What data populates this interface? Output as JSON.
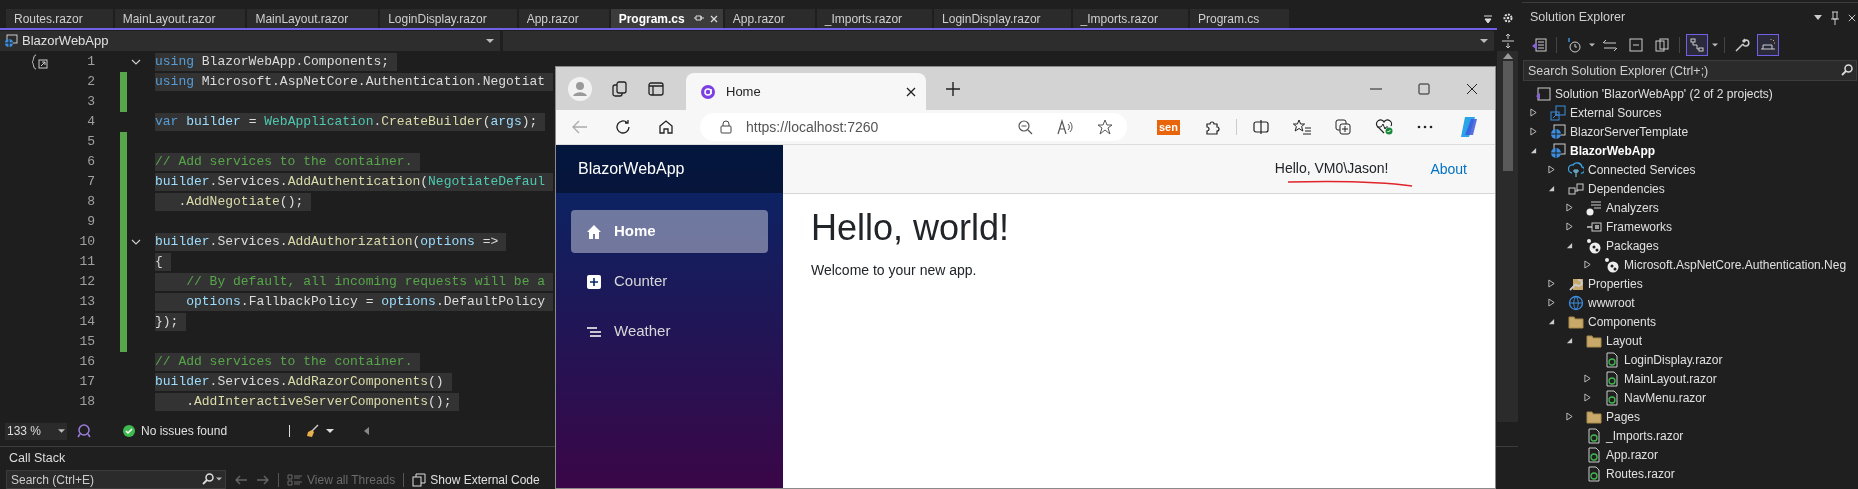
{
  "editor_tabs": [
    {
      "label": "Routes.razor",
      "selected": false
    },
    {
      "label": "MainLayout.razor",
      "selected": false
    },
    {
      "label": "MainLayout.razor",
      "selected": false
    },
    {
      "label": "LoginDisplay.razor",
      "selected": false
    },
    {
      "label": "App.razor",
      "selected": false
    },
    {
      "label": "Program.cs",
      "selected": true
    },
    {
      "label": "App.razor",
      "selected": false
    },
    {
      "label": "_Imports.razor",
      "selected": false
    },
    {
      "label": "LoginDisplay.razor",
      "selected": false
    },
    {
      "label": "_Imports.razor",
      "selected": false
    },
    {
      "label": "Program.cs",
      "selected": false
    }
  ],
  "navigation_bar": {
    "project": "BlazorWebApp"
  },
  "code_lines": [
    {
      "number": "1",
      "changed": false,
      "fold": true,
      "segments": [
        {
          "kind": "keyword",
          "text": "using"
        },
        {
          "kind": "plain",
          "text": " BlazorWebApp.Components;"
        }
      ]
    },
    {
      "number": "2",
      "changed": true,
      "fold": false,
      "segments": [
        {
          "kind": "keyword",
          "text": "using"
        },
        {
          "kind": "plain",
          "text": " Microsoft.AspNetCore.Authentication.Negotiat"
        }
      ]
    },
    {
      "number": "3",
      "changed": true,
      "fold": false
    },
    {
      "number": "4",
      "changed": false,
      "fold": false,
      "segments": [
        {
          "kind": "keyword",
          "text": "var"
        },
        {
          "kind": "variable",
          "text": " builder"
        },
        {
          "kind": "plain",
          "text": " = "
        },
        {
          "kind": "type",
          "text": "WebApplication"
        },
        {
          "kind": "plain",
          "text": "."
        },
        {
          "kind": "method",
          "text": "CreateBuilder"
        },
        {
          "kind": "plain",
          "text": "("
        },
        {
          "kind": "variable",
          "text": "args"
        },
        {
          "kind": "plain",
          "text": ");"
        }
      ]
    },
    {
      "number": "5",
      "changed": true,
      "fold": false
    },
    {
      "number": "6",
      "changed": true,
      "fold": false,
      "segments": [
        {
          "kind": "comment",
          "text": "// Add services to the container."
        }
      ]
    },
    {
      "number": "7",
      "changed": true,
      "fold": false,
      "segments": [
        {
          "kind": "variable",
          "text": "builder"
        },
        {
          "kind": "plain",
          "text": ".Services."
        },
        {
          "kind": "method",
          "text": "AddAuthentication"
        },
        {
          "kind": "plain",
          "text": "("
        },
        {
          "kind": "type",
          "text": "NegotiateDefaul"
        }
      ]
    },
    {
      "number": "8",
      "changed": true,
      "fold": false,
      "segments": [
        {
          "kind": "plain",
          "text": "   ."
        },
        {
          "kind": "method",
          "text": "AddNegotiate"
        },
        {
          "kind": "plain",
          "text": "();"
        }
      ]
    },
    {
      "number": "9",
      "changed": true,
      "fold": false
    },
    {
      "number": "10",
      "changed": true,
      "fold": true,
      "segments": [
        {
          "kind": "variable",
          "text": "builder"
        },
        {
          "kind": "plain",
          "text": ".Services."
        },
        {
          "kind": "method",
          "text": "AddAuthorization"
        },
        {
          "kind": "plain",
          "text": "("
        },
        {
          "kind": "variable",
          "text": "options"
        },
        {
          "kind": "plain",
          "text": " =>"
        }
      ]
    },
    {
      "number": "11",
      "changed": true,
      "fold": false,
      "segments": [
        {
          "kind": "plain",
          "text": "{"
        }
      ]
    },
    {
      "number": "12",
      "changed": true,
      "fold": false,
      "segments": [
        {
          "kind": "comment",
          "text": "    // By default, all incoming requests will be a"
        }
      ]
    },
    {
      "number": "13",
      "changed": true,
      "fold": false,
      "segments": [
        {
          "kind": "variable",
          "text": "    options"
        },
        {
          "kind": "plain",
          "text": ".FallbackPolicy = "
        },
        {
          "kind": "variable",
          "text": "options"
        },
        {
          "kind": "plain",
          "text": ".DefaultPolicy"
        }
      ]
    },
    {
      "number": "14",
      "changed": true,
      "fold": false,
      "segments": [
        {
          "kind": "plain",
          "text": "});"
        }
      ]
    },
    {
      "number": "15",
      "changed": true,
      "fold": false
    },
    {
      "number": "16",
      "changed": false,
      "fold": false,
      "segments": [
        {
          "kind": "comment",
          "text": "// Add services to the container."
        }
      ]
    },
    {
      "number": "17",
      "changed": false,
      "fold": false,
      "segments": [
        {
          "kind": "variable",
          "text": "builder"
        },
        {
          "kind": "plain",
          "text": ".Services."
        },
        {
          "kind": "method",
          "text": "AddRazorComponents"
        },
        {
          "kind": "plain",
          "text": "()"
        }
      ]
    },
    {
      "number": "18",
      "changed": false,
      "fold": false,
      "segments": [
        {
          "kind": "plain",
          "text": "    ."
        },
        {
          "kind": "method",
          "text": "AddInteractiveServerComponents"
        },
        {
          "kind": "plain",
          "text": "();"
        }
      ]
    }
  ],
  "editor_status": {
    "zoom": "133 %",
    "issues": "No issues found"
  },
  "call_stack": {
    "title": "Call Stack",
    "search_placeholder": "Search (Ctrl+E)",
    "buttons": [
      {
        "label": "View all Threads",
        "disabled": true
      },
      {
        "label": "Show External Code",
        "disabled": false
      }
    ]
  },
  "browser": {
    "tabs": [
      {
        "title": "Home",
        "selected": true
      }
    ],
    "url": "https://localhost:7260",
    "extension_badge": "sen",
    "app": {
      "brand": "BlazorWebApp",
      "nav": [
        {
          "label": "Home",
          "kind": "house",
          "selected": true
        },
        {
          "label": "Counter",
          "kind": "plus",
          "selected": false
        },
        {
          "label": "Weather",
          "kind": "list",
          "selected": false
        }
      ],
      "greeting": "Hello, VM0\\Jason!",
      "about_link": "About",
      "heading": "Hello, world!",
      "text": "Welcome to your new app."
    }
  },
  "solution_explorer": {
    "title": "Solution Explorer",
    "toolbar": [
      {
        "kind": "vs",
        "on": false
      },
      {
        "kind": "history",
        "on": false
      },
      {
        "kind": "sync",
        "on": false
      },
      {
        "kind": "collapse",
        "on": false
      },
      {
        "kind": "views",
        "on": false
      },
      {
        "kind": "tree",
        "on": true
      },
      {
        "kind": "wrench",
        "on": false
      },
      {
        "kind": "preview",
        "on": true
      }
    ],
    "search_placeholder": "Search Solution Explorer (Ctrl+;)",
    "tree": {
      "label": "Solution 'BlazorWebApp' (2 of 2 projects)",
      "kind": "solution",
      "children": [
        {
          "label": "External Sources",
          "kind": "external",
          "expanded": false
        },
        {
          "label": "BlazorServerTemplate",
          "kind": "project",
          "expanded": false
        },
        {
          "label": "BlazorWebApp",
          "kind": "project",
          "expanded": true,
          "startup": true,
          "children": [
            {
              "label": "Connected Services",
              "kind": "connected",
              "expanded": false
            },
            {
              "label": "Dependencies",
              "kind": "dependencies",
              "expanded": true,
              "children": [
                {
                  "label": "Analyzers",
                  "kind": "analyzers",
                  "expanded": false
                },
                {
                  "label": "Frameworks",
                  "kind": "frameworks",
                  "expanded": false
                },
                {
                  "label": "Packages",
                  "kind": "package",
                  "expanded": true,
                  "children": [
                    {
                      "label": "Microsoft.AspNetCore.Authentication.Neg",
                      "kind": "package",
                      "expanded": false
                    }
                  ]
                }
              ]
            },
            {
              "label": "Properties",
              "kind": "properties",
              "expanded": false
            },
            {
              "label": "wwwroot",
              "kind": "globe",
              "expanded": false
            },
            {
              "label": "Components",
              "kind": "folder",
              "expanded": true,
              "children": [
                {
                  "label": "Layout",
                  "kind": "folder",
                  "expanded": true,
                  "children": [
                    {
                      "label": "LoginDisplay.razor",
                      "kind": "razor"
                    },
                    {
                      "label": "MainLayout.razor",
                      "kind": "razor",
                      "expanded": false
                    },
                    {
                      "label": "NavMenu.razor",
                      "kind": "razor",
                      "expanded": false
                    }
                  ]
                },
                {
                  "label": "Pages",
                  "kind": "folder",
                  "expanded": false
                },
                {
                  "label": "_Imports.razor",
                  "kind": "razor"
                },
                {
                  "label": "App.razor",
                  "kind": "razor"
                },
                {
                  "label": "Routes.razor",
                  "kind": "razor"
                }
              ]
            }
          ]
        }
      ]
    }
  }
}
